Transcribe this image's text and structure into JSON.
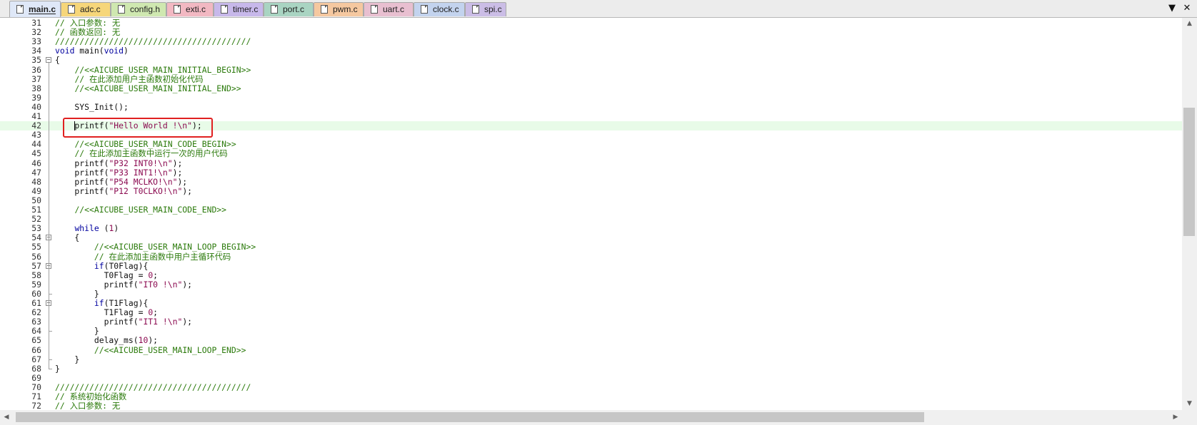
{
  "tabs": [
    {
      "label": "main.c",
      "color": "#c9d8f2",
      "active": true
    },
    {
      "label": "adc.c",
      "color": "#f6d67a"
    },
    {
      "label": "config.h",
      "color": "#cfe8b0"
    },
    {
      "label": "exti.c",
      "color": "#f2b8c2"
    },
    {
      "label": "timer.c",
      "color": "#c7b8ea"
    },
    {
      "label": "port.c",
      "color": "#a9d4c2"
    },
    {
      "label": "pwm.c",
      "color": "#f5c8a0"
    },
    {
      "label": "uart.c",
      "color": "#e8bfd0"
    },
    {
      "label": "clock.c",
      "color": "#c3d3ee"
    },
    {
      "label": "spi.c",
      "color": "#cbbde6"
    }
  ],
  "tab_dropdown_icon": "chevron-down-icon",
  "close_icon": "close-icon",
  "tab_dropdown_glyph": "▼",
  "close_glyph": "✕",
  "editor": {
    "current_line": 42,
    "lines": [
      {
        "no": "31",
        "text": "// 入口参数: 无"
      },
      {
        "no": "32",
        "text": "// 函数返回: 无"
      },
      {
        "no": "33",
        "text": "////////////////////////////////////////"
      },
      {
        "no": "34",
        "text": "void main(void)"
      },
      {
        "no": "35",
        "text": "{"
      },
      {
        "no": "36",
        "text": "    //<<AICUBE_USER_MAIN_INITIAL_BEGIN>>"
      },
      {
        "no": "37",
        "text": "    // 在此添加用户主函数初始化代码"
      },
      {
        "no": "38",
        "text": "    //<<AICUBE_USER_MAIN_INITIAL_END>>"
      },
      {
        "no": "39",
        "text": ""
      },
      {
        "no": "40",
        "text": "    SYS_Init();"
      },
      {
        "no": "41",
        "text": ""
      },
      {
        "no": "42",
        "text": "    printf(\"Hello World !\\n\");"
      },
      {
        "no": "43",
        "text": ""
      },
      {
        "no": "44",
        "text": "    //<<AICUBE_USER_MAIN_CODE_BEGIN>>"
      },
      {
        "no": "45",
        "text": "    // 在此添加主函数中运行一次的用户代码"
      },
      {
        "no": "46",
        "text": "    printf(\"P32 INT0!\\n\");"
      },
      {
        "no": "47",
        "text": "    printf(\"P33 INT1!\\n\");"
      },
      {
        "no": "48",
        "text": "    printf(\"P54 MCLKO!\\n\");"
      },
      {
        "no": "49",
        "text": "    printf(\"P12 T0CLKO!\\n\");"
      },
      {
        "no": "50",
        "text": ""
      },
      {
        "no": "51",
        "text": "    //<<AICUBE_USER_MAIN_CODE_END>>"
      },
      {
        "no": "52",
        "text": ""
      },
      {
        "no": "53",
        "text": "    while (1)"
      },
      {
        "no": "54",
        "text": "    {"
      },
      {
        "no": "55",
        "text": "        //<<AICUBE_USER_MAIN_LOOP_BEGIN>>"
      },
      {
        "no": "56",
        "text": "        // 在此添加主函数中用户主循环代码"
      },
      {
        "no": "57",
        "text": "        if(T0Flag){"
      },
      {
        "no": "58",
        "text": "          T0Flag = 0;"
      },
      {
        "no": "59",
        "text": "          printf(\"IT0 !\\n\");"
      },
      {
        "no": "60",
        "text": "        }"
      },
      {
        "no": "61",
        "text": "        if(T1Flag){"
      },
      {
        "no": "62",
        "text": "          T1Flag = 0;"
      },
      {
        "no": "63",
        "text": "          printf(\"IT1 !\\n\");"
      },
      {
        "no": "64",
        "text": "        }"
      },
      {
        "no": "65",
        "text": "        delay_ms(10);"
      },
      {
        "no": "66",
        "text": "        //<<AICUBE_USER_MAIN_LOOP_END>>"
      },
      {
        "no": "67",
        "text": "    }"
      },
      {
        "no": "68",
        "text": "}"
      },
      {
        "no": "69",
        "text": ""
      },
      {
        "no": "70",
        "text": "////////////////////////////////////////"
      },
      {
        "no": "71",
        "text": "// 系统初始化函数"
      },
      {
        "no": "72",
        "text": "// 入口参数: 无"
      }
    ],
    "fold_markers": [
      35,
      54,
      57,
      61
    ],
    "fold_ends": [
      60,
      64,
      67,
      68
    ]
  },
  "scrollbars": {
    "up_arrow": "▲",
    "down_arrow": "▼",
    "left_arrow": "◀",
    "right_arrow": "▶"
  }
}
